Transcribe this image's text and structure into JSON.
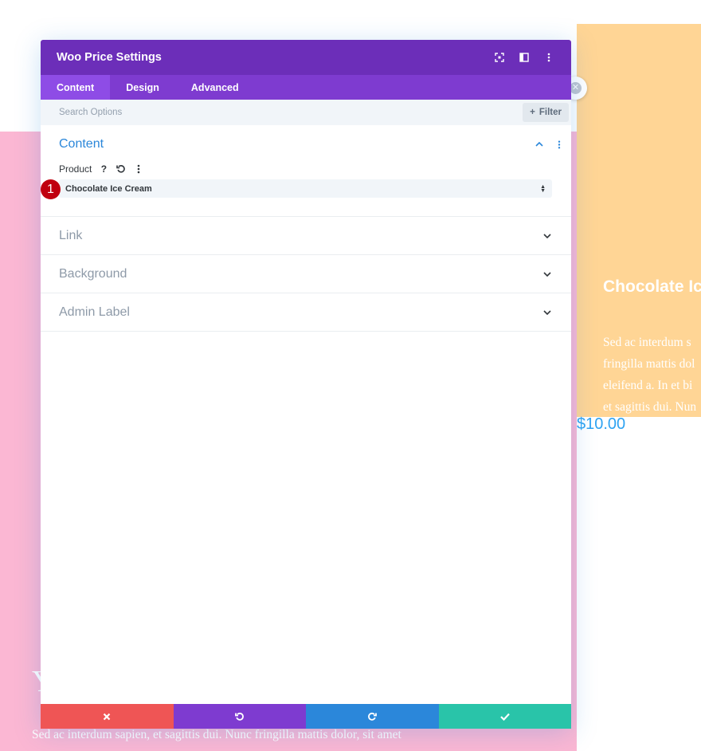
{
  "background": {
    "peach_card": {
      "title": "Chocolate Ic",
      "text_lines": [
        "Sed ac interdum s",
        "fringilla mattis dol",
        "eleifend a. In et bi",
        "et sagittis dui. Nun"
      ]
    },
    "price": "$10.00",
    "pink_heading": "Y",
    "pink_text": "Sed ac interdum sapien, et sagittis dui. Nunc fringilla mattis dolor, sit amet"
  },
  "modal": {
    "title": "Woo Price Settings",
    "tabs": [
      {
        "label": "Content",
        "active": true
      },
      {
        "label": "Design",
        "active": false
      },
      {
        "label": "Advanced",
        "active": false
      }
    ],
    "search": {
      "placeholder": "Search Options",
      "filter_label": "Filter"
    },
    "sections": {
      "content": {
        "title": "Content",
        "field_label": "Product",
        "help_glyph": "?",
        "select_value": "Chocolate Ice Cream"
      },
      "link": {
        "title": "Link"
      },
      "background": {
        "title": "Background"
      },
      "admin_label": {
        "title": "Admin Label"
      }
    }
  },
  "annotation": {
    "step": "1"
  },
  "colors": {
    "header": "#6c2eb9",
    "tabs": "#7e3bd0",
    "active_tab": "#8e4ce6",
    "cancel": "#ef5555",
    "undo": "#7e3bd0",
    "redo": "#2b87da",
    "save": "#29c4a9",
    "pink_bg": "#fbb7d3",
    "peach_bg": "#ffd595",
    "price": "#2ea3f2"
  },
  "icons": {
    "header": [
      "fullscreen-icon",
      "split-view-icon",
      "more-options-icon"
    ],
    "footer": [
      "close-icon",
      "undo-icon",
      "redo-icon",
      "check-icon"
    ]
  }
}
